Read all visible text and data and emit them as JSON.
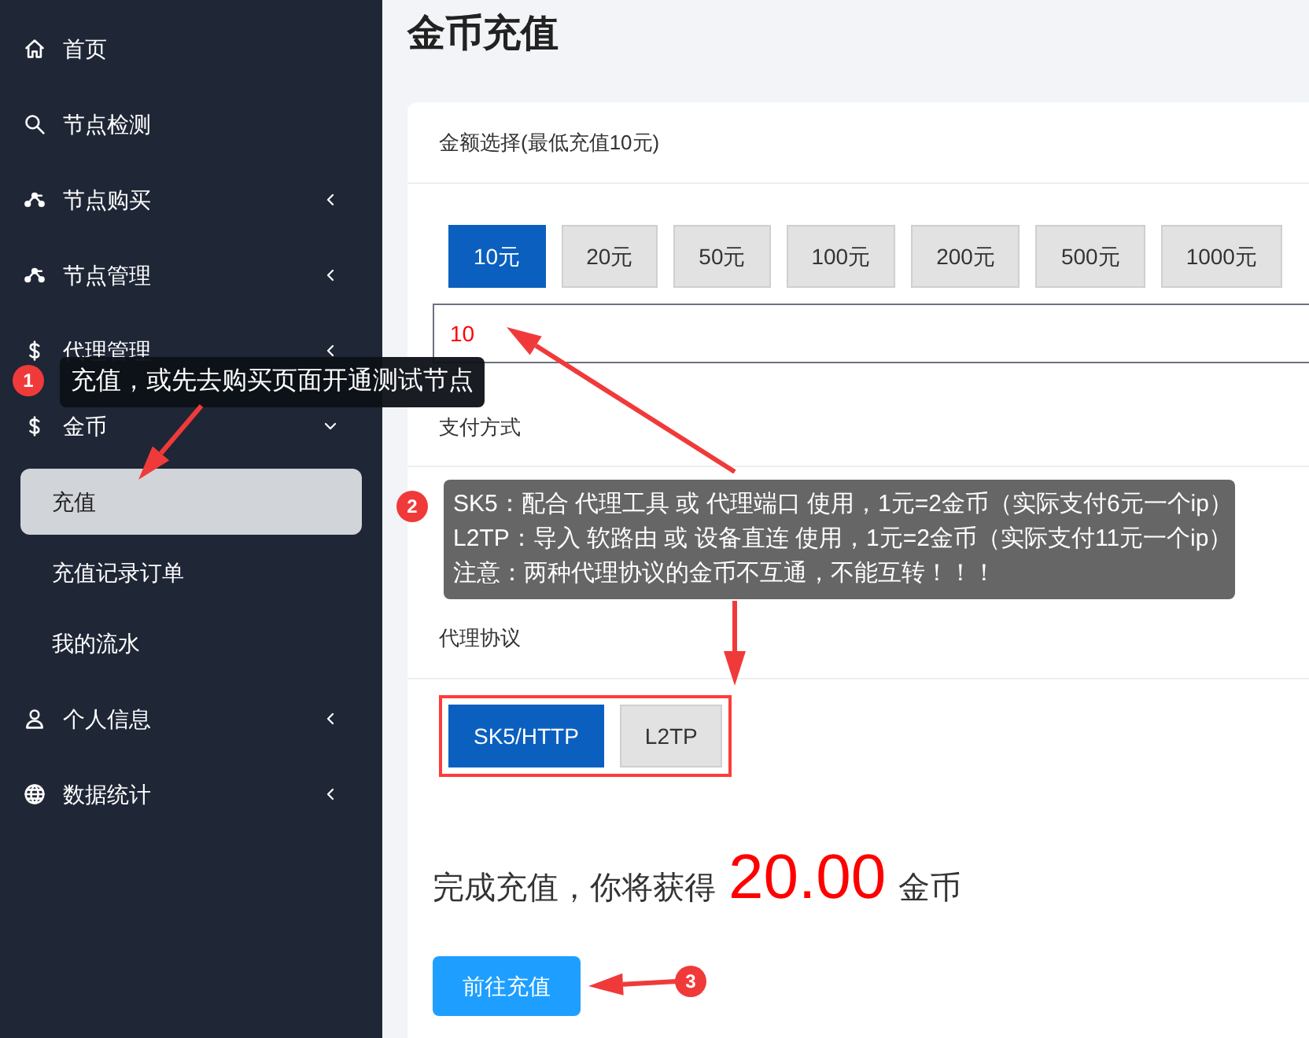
{
  "sidebar": {
    "items": [
      {
        "label": "首页",
        "kind": "link"
      },
      {
        "label": "节点检测",
        "kind": "link"
      },
      {
        "label": "节点购买",
        "kind": "menu",
        "expanded": false
      },
      {
        "label": "节点管理",
        "kind": "menu",
        "expanded": false
      },
      {
        "label": "代理管理",
        "kind": "menu",
        "expanded": false
      },
      {
        "label": "金币",
        "kind": "menu",
        "expanded": true,
        "children": [
          {
            "label": "充值",
            "selected": true
          },
          {
            "label": "充值记录订单",
            "selected": false
          },
          {
            "label": "我的流水",
            "selected": false
          }
        ]
      },
      {
        "label": "个人信息",
        "kind": "menu",
        "expanded": false
      },
      {
        "label": "数据统计",
        "kind": "menu",
        "expanded": false
      }
    ]
  },
  "page_title": "金币充值",
  "amount": {
    "label": "金额选择(最低充值10元)",
    "options": [
      {
        "label": "10元",
        "selected": true
      },
      {
        "label": "20元",
        "selected": false
      },
      {
        "label": "50元",
        "selected": false
      },
      {
        "label": "100元",
        "selected": false
      },
      {
        "label": "200元",
        "selected": false
      },
      {
        "label": "500元",
        "selected": false
      },
      {
        "label": "1000元",
        "selected": false
      }
    ],
    "value": "10"
  },
  "payment": {
    "label": "支付方式"
  },
  "protocol": {
    "label": "代理协议",
    "options": [
      {
        "label": "SK5/HTTP",
        "selected": true
      },
      {
        "label": "L2TP",
        "selected": false
      }
    ]
  },
  "result": {
    "prefix": "完成充值，你将获得",
    "amount": "20.00",
    "unit": "金币"
  },
  "submit": "前往充值",
  "annotations": [
    {
      "number": "1",
      "lines": [
        "充值，或先去购买页面开通测试节点"
      ]
    },
    {
      "number": "2",
      "lines": [
        "SK5：配合 代理工具 或 代理端口 使用，1元=2金币（实际支付6元一个ip）",
        "L2TP：导入 软路由 或 设备直连 使用，1元=2金币（实际支付11元一个ip）",
        "注意：两种代理协议的金币不互通，不能互转！！！"
      ]
    },
    {
      "number": "3"
    }
  ]
}
